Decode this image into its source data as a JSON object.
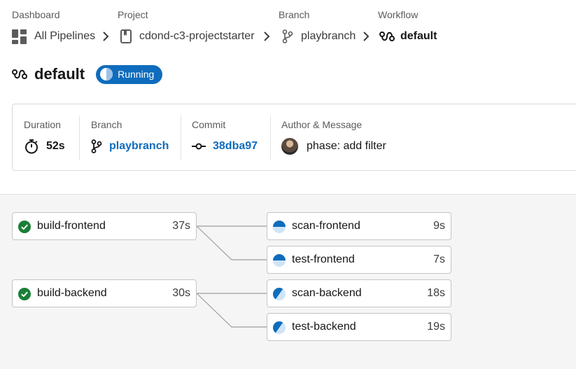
{
  "breadcrumb": {
    "labels": [
      "Dashboard",
      "Project",
      "Branch",
      "Workflow"
    ],
    "items": [
      {
        "text": "All Pipelines",
        "icon": "dashboard-icon"
      },
      {
        "text": "cdond-c3-projectstarter",
        "icon": "repo-icon"
      },
      {
        "text": "playbranch",
        "icon": "branch-icon"
      },
      {
        "text": "default",
        "icon": "workflow-icon"
      }
    ]
  },
  "header": {
    "title": "default",
    "status": "Running"
  },
  "summary": {
    "duration_label": "Duration",
    "duration": "52s",
    "branch_label": "Branch",
    "branch": "playbranch",
    "commit_label": "Commit",
    "commit": "38dba97",
    "author_label": "Author & Message",
    "message": "phase: add filter"
  },
  "jobs": [
    {
      "name": "build-frontend",
      "duration": "37s",
      "status": "success"
    },
    {
      "name": "scan-frontend",
      "duration": "9s",
      "status": "running"
    },
    {
      "name": "test-frontend",
      "duration": "7s",
      "status": "running"
    },
    {
      "name": "build-backend",
      "duration": "30s",
      "status": "success"
    },
    {
      "name": "scan-backend",
      "duration": "18s",
      "status": "running"
    },
    {
      "name": "test-backend",
      "duration": "19s",
      "status": "running"
    }
  ],
  "colors": {
    "accent": "#0f6cbd",
    "success": "#1a7f37",
    "running_light": "#cfe4f7"
  }
}
